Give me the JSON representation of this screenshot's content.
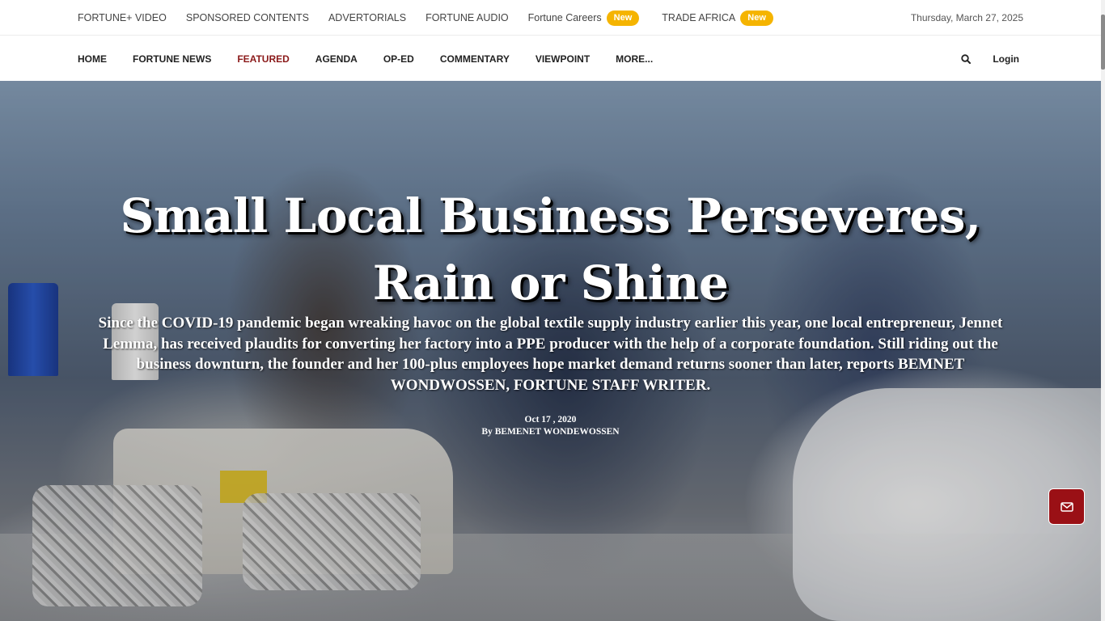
{
  "topbar": {
    "links": [
      {
        "label": "FORTUNE+ VIDEO"
      },
      {
        "label": "SPONSORED CONTENTS"
      },
      {
        "label": "ADVERTORIALS"
      },
      {
        "label": "FORTUNE AUDIO"
      },
      {
        "label": "Fortune Careers",
        "badge": "New"
      },
      {
        "label": "TRADE AFRICA",
        "badge": "New"
      }
    ],
    "date": "Thursday, March 27, 2025"
  },
  "nav": {
    "items": [
      {
        "label": "HOME"
      },
      {
        "label": "FORTUNE NEWS"
      },
      {
        "label": "FEATURED",
        "active": true
      },
      {
        "label": "AGENDA"
      },
      {
        "label": "OP-ED"
      },
      {
        "label": "COMMENTARY"
      },
      {
        "label": "VIEWPOINT"
      },
      {
        "label": "MORE..."
      }
    ],
    "search_icon": "search-icon",
    "login_label": "Login"
  },
  "hero": {
    "title": "Small Local Business Perseveres, Rain or Shine",
    "excerpt": "Since the COVID-19 pandemic began wreaking havoc on the global textile supply industry earlier this year, one local entrepreneur, Jennet Lemma, has received plaudits for converting her factory into a PPE producer with the help of a corporate foundation. Still riding out the business downturn, the founder and her 100-plus employees hope market demand returns sooner than later, reports BEMNET WONDWOSSEN, FORTUNE STAFF WRITER.",
    "date": "Oct 17 , 2020",
    "by_prefix": "By",
    "author": "BEMENET WONDEWOSSEN",
    "image_icon": "sewing-factory-photo"
  },
  "floating": {
    "mail_icon": "envelope-icon"
  },
  "colors": {
    "accent": "#8b1a1a",
    "badge": "#f5b400",
    "mail_button": "#9a1015"
  }
}
